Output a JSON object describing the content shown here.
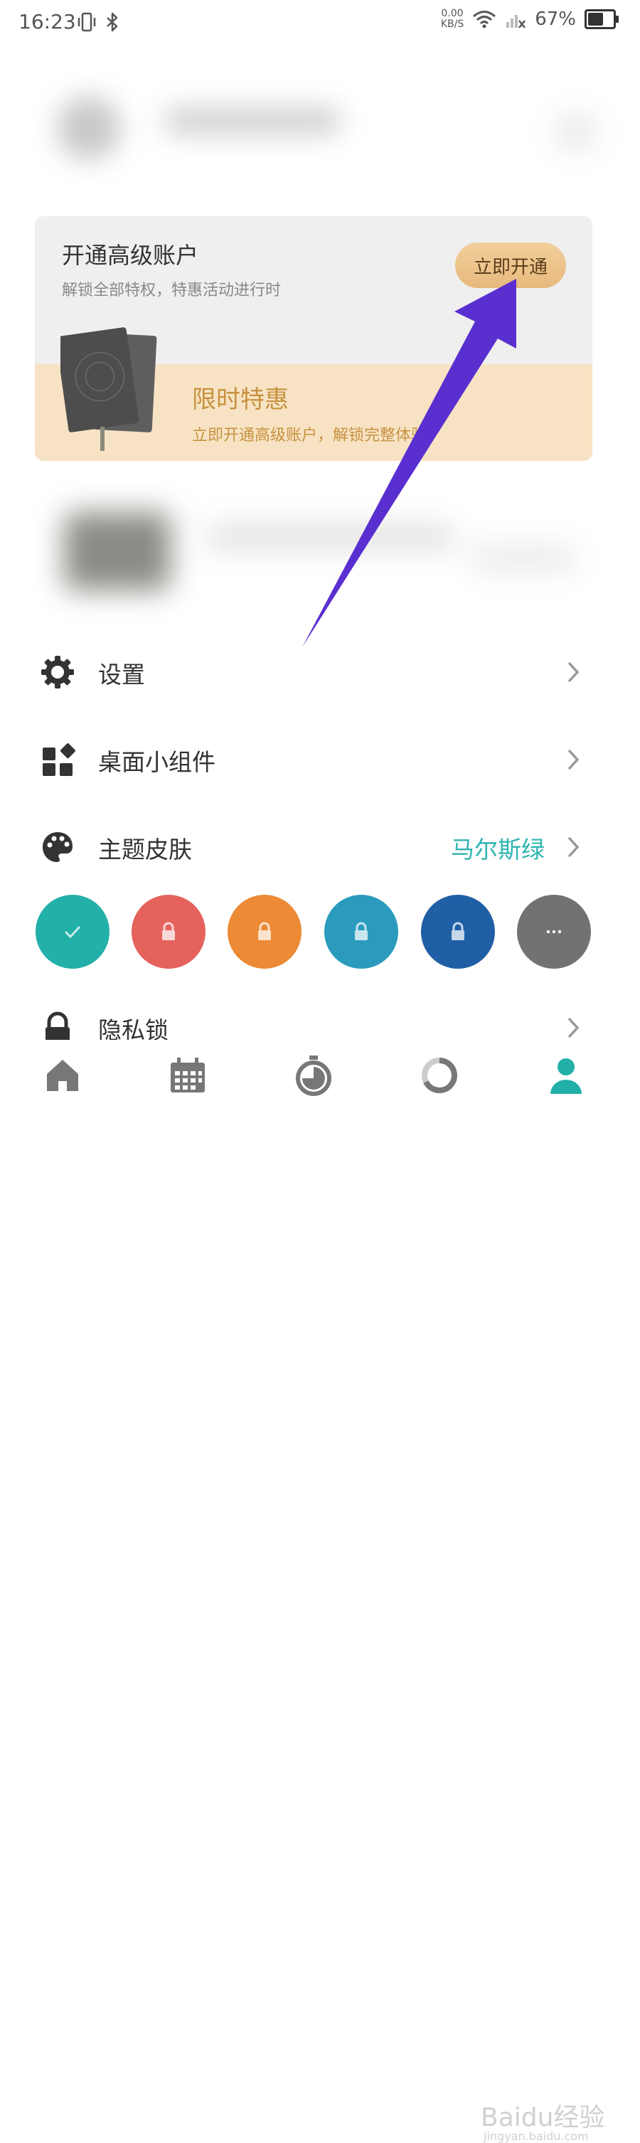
{
  "status_bar": {
    "time": "16:23",
    "net_speed_value": "0.00",
    "net_speed_unit": "KB/S",
    "battery_percent": "67%",
    "battery_level": 0.67
  },
  "premium": {
    "title": "开通高级账户",
    "subtitle": "解锁全部特权，特惠活动进行时",
    "activate_label": "立即开通",
    "promo_title": "限时特惠",
    "promo_subtitle": "立即开通高级账户，解锁完整体验"
  },
  "menu": {
    "settings": "设置",
    "widgets": "桌面小组件",
    "theme": "主题皮肤",
    "theme_value": "马尔斯绿",
    "privacy_lock": "隐私锁"
  },
  "theme_swatches": [
    {
      "color": "#22b0a8",
      "state": "selected",
      "icon": "check-icon"
    },
    {
      "color": "#e5625d",
      "state": "locked",
      "icon": "lock-icon"
    },
    {
      "color": "#ec8a36",
      "state": "locked",
      "icon": "lock-icon"
    },
    {
      "color": "#2a9bbd",
      "state": "locked",
      "icon": "lock-icon"
    },
    {
      "color": "#1f5fa6",
      "state": "locked",
      "icon": "lock-icon"
    },
    {
      "color": "#727272",
      "state": "more",
      "icon": "more-icon"
    }
  ],
  "bottom_nav": [
    "home-icon",
    "calendar-icon",
    "timer-icon",
    "stats-icon",
    "profile-icon"
  ],
  "watermark": {
    "main": "Baidu经验",
    "sub": "jingyan.baidu.com"
  },
  "colors": {
    "accent": "#2fb5b0",
    "annotation_arrow": "#5a2fd0",
    "activate_button": "#e9bd82"
  }
}
